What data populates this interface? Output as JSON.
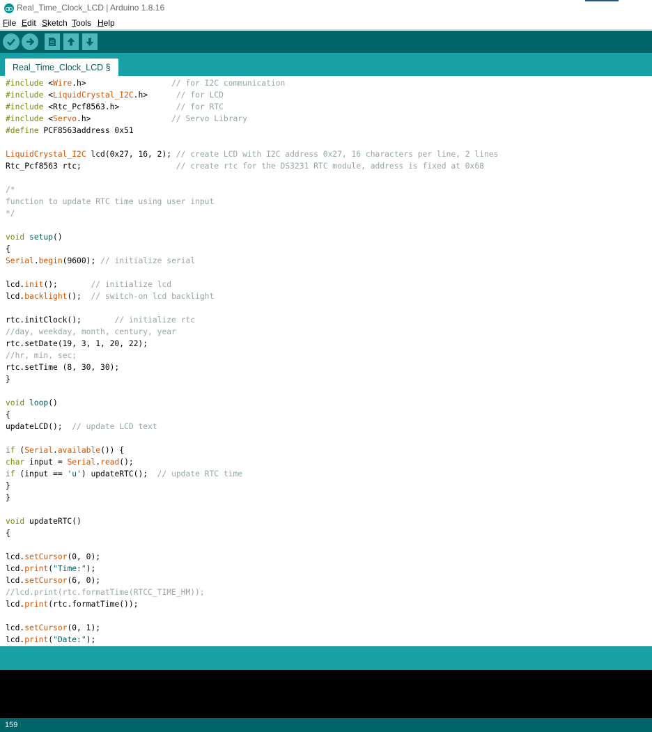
{
  "window": {
    "title": "Real_Time_Clock_LCD | Arduino 1.8.16"
  },
  "menu": [
    {
      "mnemonic": "F",
      "rest": "ile"
    },
    {
      "mnemonic": "E",
      "rest": "dit"
    },
    {
      "mnemonic": "S",
      "rest": "ketch"
    },
    {
      "mnemonic": "T",
      "rest": "ools"
    },
    {
      "mnemonic": "H",
      "rest": "elp"
    }
  ],
  "toolbar": {
    "buttons": [
      "verify-icon",
      "upload-icon",
      "new-icon",
      "open-icon",
      "save-icon"
    ]
  },
  "tabs": [
    {
      "label": "Real_Time_Clock_LCD §"
    }
  ],
  "colors": {
    "teal_dark": "#006468",
    "teal": "#17a1a5",
    "button": "#4db7bb",
    "keyword": "#728e00",
    "function": "#d35400",
    "string": "#005c5f",
    "comment": "#95a5a6"
  },
  "code": [
    [
      {
        "t": "kw",
        "s": "#include"
      },
      {
        "t": "tx",
        "s": " <"
      },
      {
        "t": "fn",
        "s": "Wire"
      },
      {
        "t": "tx",
        "s": ".h>                  "
      },
      {
        "t": "cm",
        "s": "// for I2C communication"
      }
    ],
    [
      {
        "t": "kw",
        "s": "#include"
      },
      {
        "t": "tx",
        "s": " <"
      },
      {
        "t": "fn",
        "s": "LiquidCrystal_I2C"
      },
      {
        "t": "tx",
        "s": ".h>      "
      },
      {
        "t": "cm",
        "s": "// for LCD"
      }
    ],
    [
      {
        "t": "kw",
        "s": "#include"
      },
      {
        "t": "tx",
        "s": " <Rtc_Pcf8563.h>            "
      },
      {
        "t": "cm",
        "s": "// for RTC"
      }
    ],
    [
      {
        "t": "kw",
        "s": "#include"
      },
      {
        "t": "tx",
        "s": " <"
      },
      {
        "t": "fn",
        "s": "Servo"
      },
      {
        "t": "tx",
        "s": ".h>                 "
      },
      {
        "t": "cm",
        "s": "// Servo Library"
      }
    ],
    [
      {
        "t": "kw",
        "s": "#define"
      },
      {
        "t": "tx",
        "s": " PCF8563address 0x51"
      }
    ],
    [],
    [
      {
        "t": "lb",
        "s": "LiquidCrystal_I2C"
      },
      {
        "t": "tx",
        "s": " lcd(0x27, 16, 2); "
      },
      {
        "t": "cm",
        "s": "// create LCD with I2C address 0x27, 16 characters per line, 2 lines"
      }
    ],
    [
      {
        "t": "tx",
        "s": "Rtc_Pcf8563 rtc;                    "
      },
      {
        "t": "cm",
        "s": "// create rtc for the DS3231 RTC module, address is fixed at 0x68"
      }
    ],
    [],
    [
      {
        "t": "cm",
        "s": "/*"
      }
    ],
    [
      {
        "t": "cm",
        "s": "function to update RTC time using user input"
      }
    ],
    [
      {
        "t": "cm",
        "s": "*/"
      }
    ],
    [],
    [
      {
        "t": "kw",
        "s": "void"
      },
      {
        "t": "tx",
        "s": " "
      },
      {
        "t": "str",
        "s": "setup"
      },
      {
        "t": "tx",
        "s": "()"
      }
    ],
    [
      {
        "t": "tx",
        "s": "{"
      }
    ],
    [
      {
        "t": "lb",
        "s": "Serial"
      },
      {
        "t": "tx",
        "s": "."
      },
      {
        "t": "fn",
        "s": "begin"
      },
      {
        "t": "tx",
        "s": "(9600); "
      },
      {
        "t": "cm",
        "s": "// initialize serial"
      }
    ],
    [],
    [
      {
        "t": "tx",
        "s": "lcd."
      },
      {
        "t": "fn",
        "s": "init"
      },
      {
        "t": "tx",
        "s": "();       "
      },
      {
        "t": "cm",
        "s": "// initialize lcd"
      }
    ],
    [
      {
        "t": "tx",
        "s": "lcd."
      },
      {
        "t": "fn",
        "s": "backlight"
      },
      {
        "t": "tx",
        "s": "();  "
      },
      {
        "t": "cm",
        "s": "// switch-on lcd backlight"
      }
    ],
    [],
    [
      {
        "t": "tx",
        "s": "rtc.initClock();       "
      },
      {
        "t": "cm",
        "s": "// initialize rtc"
      }
    ],
    [
      {
        "t": "cm",
        "s": "//day, weekday, month, century, year"
      }
    ],
    [
      {
        "t": "tx",
        "s": "rtc.setDate(19, 3, 1, 20, 22);"
      }
    ],
    [
      {
        "t": "cm",
        "s": "//hr, min, sec;"
      }
    ],
    [
      {
        "t": "tx",
        "s": "rtc.setTime (8, 30, 30);"
      }
    ],
    [
      {
        "t": "tx",
        "s": "}"
      }
    ],
    [],
    [
      {
        "t": "kw",
        "s": "void"
      },
      {
        "t": "tx",
        "s": " "
      },
      {
        "t": "str",
        "s": "loop"
      },
      {
        "t": "tx",
        "s": "()"
      }
    ],
    [
      {
        "t": "tx",
        "s": "{"
      }
    ],
    [
      {
        "t": "tx",
        "s": "updateLCD();  "
      },
      {
        "t": "cm",
        "s": "// update LCD text"
      }
    ],
    [],
    [
      {
        "t": "kw",
        "s": "if"
      },
      {
        "t": "tx",
        "s": " ("
      },
      {
        "t": "lb",
        "s": "Serial"
      },
      {
        "t": "tx",
        "s": "."
      },
      {
        "t": "fn",
        "s": "available"
      },
      {
        "t": "tx",
        "s": "()) {"
      }
    ],
    [
      {
        "t": "kw",
        "s": "char"
      },
      {
        "t": "tx",
        "s": " input = "
      },
      {
        "t": "lb",
        "s": "Serial"
      },
      {
        "t": "tx",
        "s": "."
      },
      {
        "t": "fn",
        "s": "read"
      },
      {
        "t": "tx",
        "s": "();"
      }
    ],
    [
      {
        "t": "kw",
        "s": "if"
      },
      {
        "t": "tx",
        "s": " (input == "
      },
      {
        "t": "str",
        "s": "'u'"
      },
      {
        "t": "tx",
        "s": ") updateRTC();  "
      },
      {
        "t": "cm",
        "s": "// update RTC time"
      }
    ],
    [
      {
        "t": "tx",
        "s": "}"
      }
    ],
    [
      {
        "t": "tx",
        "s": "}"
      }
    ],
    [],
    [
      {
        "t": "kw",
        "s": "void"
      },
      {
        "t": "tx",
        "s": " updateRTC()"
      }
    ],
    [
      {
        "t": "tx",
        "s": "{"
      }
    ],
    [],
    [
      {
        "t": "tx",
        "s": "lcd."
      },
      {
        "t": "fn",
        "s": "setCursor"
      },
      {
        "t": "tx",
        "s": "(0, 0);"
      }
    ],
    [
      {
        "t": "tx",
        "s": "lcd."
      },
      {
        "t": "fn",
        "s": "print"
      },
      {
        "t": "tx",
        "s": "("
      },
      {
        "t": "str",
        "s": "\"Time:\""
      },
      {
        "t": "tx",
        "s": ");"
      }
    ],
    [
      {
        "t": "tx",
        "s": "lcd."
      },
      {
        "t": "fn",
        "s": "setCursor"
      },
      {
        "t": "tx",
        "s": "(6, 0);"
      }
    ],
    [
      {
        "t": "cm",
        "s": "//lcd.print(rtc.formatTime(RTCC_TIME_HM));"
      }
    ],
    [
      {
        "t": "tx",
        "s": "lcd."
      },
      {
        "t": "fn",
        "s": "print"
      },
      {
        "t": "tx",
        "s": "(rtc.formatTime());"
      }
    ],
    [],
    [
      {
        "t": "tx",
        "s": "lcd."
      },
      {
        "t": "fn",
        "s": "setCursor"
      },
      {
        "t": "tx",
        "s": "(0, 1);"
      }
    ],
    [
      {
        "t": "tx",
        "s": "lcd."
      },
      {
        "t": "fn",
        "s": "print"
      },
      {
        "t": "tx",
        "s": "("
      },
      {
        "t": "str",
        "s": "\"Date:\""
      },
      {
        "t": "tx",
        "s": ");"
      }
    ]
  ],
  "status": {
    "line_number": "159"
  }
}
